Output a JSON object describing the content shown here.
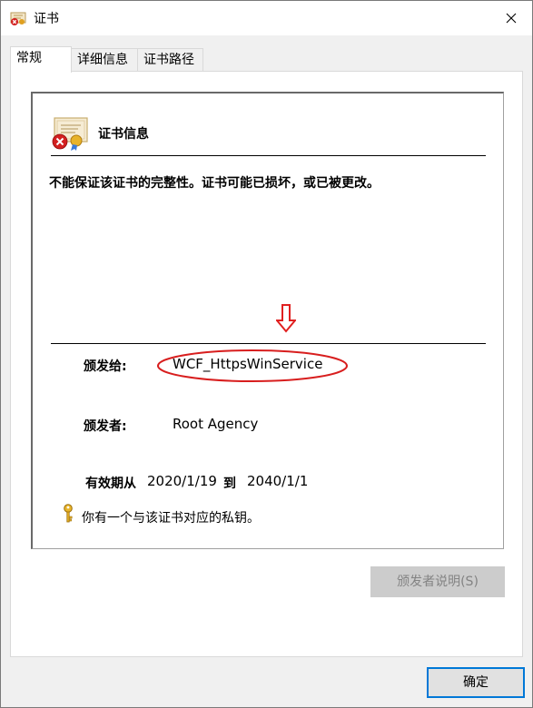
{
  "window": {
    "title": "证书",
    "title_icon": "certificate-icon",
    "close_icon": "close-icon"
  },
  "tabs": [
    {
      "label": "常规",
      "active": true
    },
    {
      "label": "详细信息",
      "active": false
    },
    {
      "label": "证书路径",
      "active": false
    }
  ],
  "cert": {
    "heading": "证书信息",
    "warning": "不能保证该证书的完整性。证书可能已损坏，或已被更改。",
    "issued_to_label": "颁发给:",
    "issued_to_value": "WCF_HttpsWinService",
    "issued_by_label": "颁发者:",
    "issued_by_value": "Root Agency",
    "valid_from_label": "有效期从",
    "valid_from_value": "2020/1/19",
    "valid_to_label": "到",
    "valid_to_value": "2040/1/1",
    "private_key_note": "你有一个与该证书对应的私钥。"
  },
  "buttons": {
    "issuer_statement": "颁发者说明(S)",
    "ok": "确定"
  },
  "annotations": {
    "arrow_color": "#e02020",
    "oval_color": "#d81e1e"
  }
}
